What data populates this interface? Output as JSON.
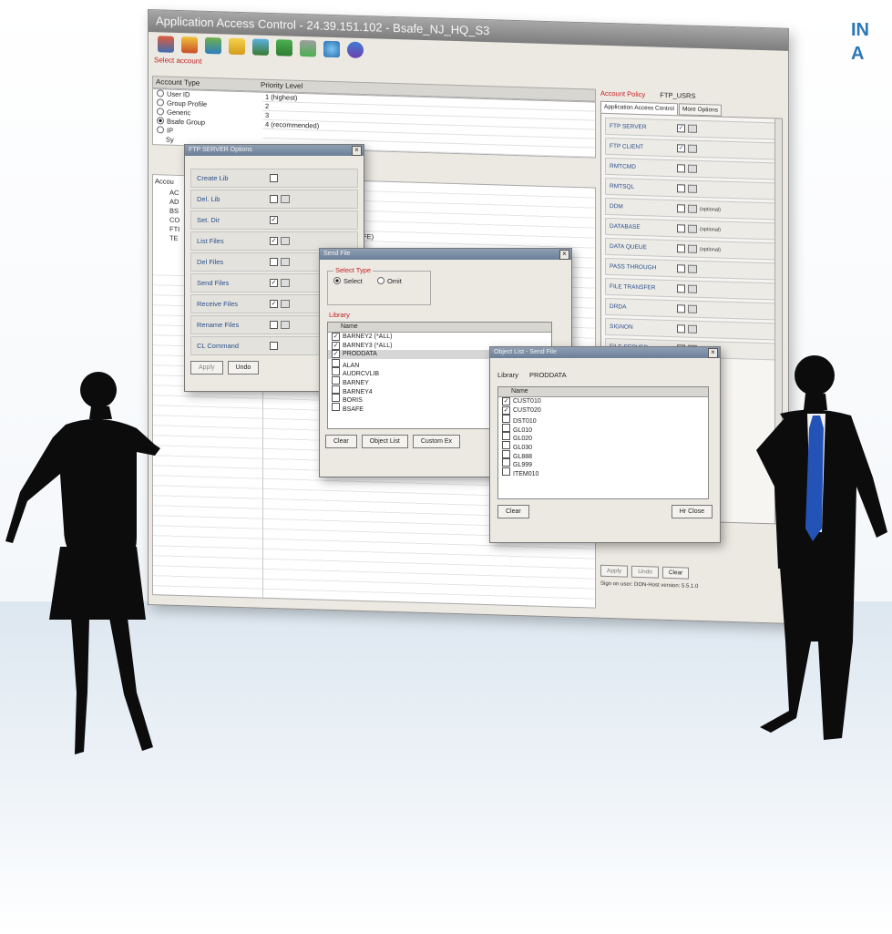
{
  "brand_text": [
    "IN",
    "A"
  ],
  "app": {
    "title": "Application Access Control - 24.39.151.102 - Bsafe_NJ_HQ_S3",
    "select_account_label": "Select account",
    "columns": [
      "Account Type",
      "Priority Level"
    ],
    "account_types": [
      {
        "label": "User ID",
        "priority": "1 (highest)",
        "selected": false
      },
      {
        "label": "Group Profile",
        "priority": "2",
        "selected": false
      },
      {
        "label": "Generic",
        "priority": "3",
        "selected": false
      },
      {
        "label": "Bsafe Group",
        "priority": "4 (recommended)",
        "selected": true
      },
      {
        "label": "IP",
        "priority": "",
        "selected": false
      },
      {
        "label": "Sy",
        "priority": "",
        "selected": false
      }
    ],
    "accounts_header": "Accou",
    "accounts": [
      "AC",
      "AD",
      "BS",
      "CO",
      "FTI",
      "TE"
    ],
    "partial_priority_text": "FE)",
    "toolbar_icons": [
      "users-icon",
      "group-icon",
      "network-icon",
      "folder-icon",
      "settings-icon",
      "book-icon",
      "export-icon",
      "globe-icon",
      "info-icon"
    ]
  },
  "right_panel": {
    "policy_label": "Account Policy",
    "policy_value": "FTP_USRS",
    "tabs": [
      "Application Access Control",
      "More Options"
    ],
    "services": [
      {
        "name": "FTP SERVER",
        "checked": true,
        "option": ""
      },
      {
        "name": "FTP CLIENT",
        "checked": true,
        "option": ""
      },
      {
        "name": "RMTCMD",
        "checked": false,
        "option": ""
      },
      {
        "name": "RMTSQL",
        "checked": false,
        "option": ""
      },
      {
        "name": "DDM",
        "checked": false,
        "option": "(optional)"
      },
      {
        "name": "DATABASE",
        "checked": false,
        "option": "(optional)"
      },
      {
        "name": "DATA QUEUE",
        "checked": false,
        "option": "(optional)"
      },
      {
        "name": "PASS THROUGH",
        "checked": false,
        "option": ""
      },
      {
        "name": "FILE TRANSFER",
        "checked": false,
        "option": ""
      },
      {
        "name": "DRDA",
        "checked": false,
        "option": ""
      },
      {
        "name": "SIGNON",
        "checked": false,
        "option": ""
      },
      {
        "name": "FILE SERVER",
        "checked": false,
        "option": "(optional)"
      }
    ],
    "buttons": [
      "Apply",
      "Undo",
      "Clear"
    ],
    "status": "Sign on user: DON-Host version: 5.5.1.0"
  },
  "ftp_dialog": {
    "title": "FTP SERVER Options",
    "options": [
      {
        "name": "Create Lib",
        "checked": false,
        "has_button": false
      },
      {
        "name": "Del. Lib",
        "checked": false,
        "has_button": true
      },
      {
        "name": "Set. Dir",
        "checked": true,
        "has_button": false
      },
      {
        "name": "List Files",
        "checked": true,
        "has_button": true
      },
      {
        "name": "Del Files",
        "checked": false,
        "has_button": true
      },
      {
        "name": "Send Files",
        "checked": true,
        "has_button": true
      },
      {
        "name": "Receive Files",
        "checked": true,
        "has_button": true
      },
      {
        "name": "Rename Files",
        "checked": false,
        "has_button": true
      },
      {
        "name": "CL Command",
        "checked": false,
        "has_button": false
      }
    ],
    "buttons": [
      "Apply",
      "Undo"
    ]
  },
  "send_dialog": {
    "title": "Send File",
    "select_type_label": "Select Type",
    "radio_select": "Select",
    "radio_omit": "Omit",
    "library_label": "Library",
    "name_header": "Name",
    "items": [
      {
        "name": "BARNEY2 (*ALL)",
        "checked": true
      },
      {
        "name": "BARNEY3 (*ALL)",
        "checked": true
      },
      {
        "name": "PRODDATA",
        "checked": true
      },
      {
        "name": "ALAN",
        "checked": false
      },
      {
        "name": "AUDRCVLIB",
        "checked": false
      },
      {
        "name": "BARNEY",
        "checked": false
      },
      {
        "name": "BARNEY4",
        "checked": false
      },
      {
        "name": "BORIS",
        "checked": false
      },
      {
        "name": "BSAFE",
        "checked": false
      }
    ],
    "buttons": [
      "Clear",
      "Object List",
      "Custom Ex"
    ]
  },
  "object_dialog": {
    "title": "Object List - Send File",
    "library_label": "Library",
    "library_value": "PRODDATA",
    "name_header": "Name",
    "items": [
      {
        "name": "CUST010",
        "checked": true
      },
      {
        "name": "CUST020",
        "checked": true
      },
      {
        "name": "DST010",
        "checked": false
      },
      {
        "name": "GL010",
        "checked": false
      },
      {
        "name": "GL020",
        "checked": false
      },
      {
        "name": "GL030",
        "checked": false
      },
      {
        "name": "GL888",
        "checked": false
      },
      {
        "name": "GL999",
        "checked": false
      },
      {
        "name": "ITEM010",
        "checked": false
      }
    ],
    "clear_button": "Clear",
    "close_button": "Hr Close"
  },
  "colors": {
    "accent_red": "#c21f1f",
    "title_gray": "#8a8a8a",
    "brand_blue": "#2b77b7",
    "tie_blue": "#2453b8"
  }
}
